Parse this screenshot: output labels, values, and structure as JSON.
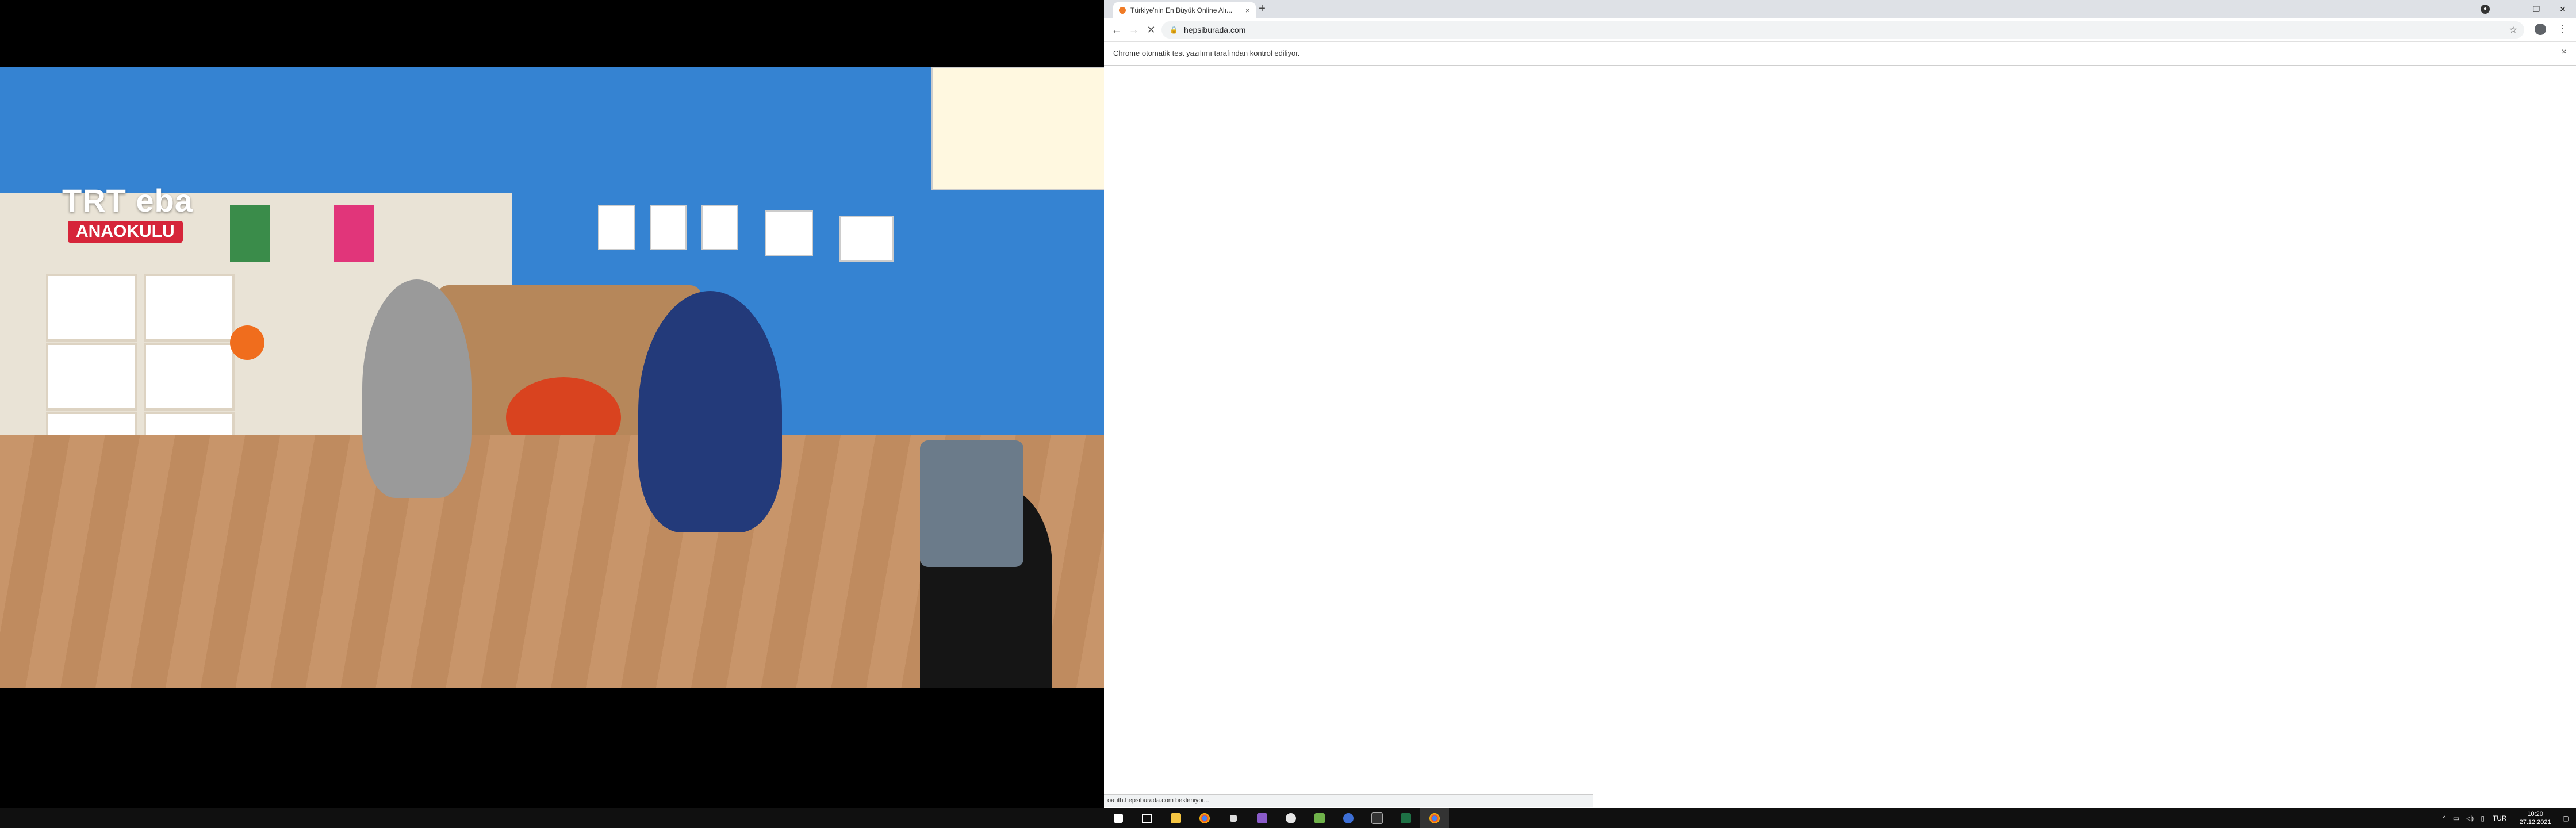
{
  "video": {
    "logo_trt": "TRT eba",
    "logo_sub": "ANAOKULU"
  },
  "browser": {
    "tab_title": "Türkiye'nin En Büyük Online Alı...",
    "tab_close": "×",
    "new_tab": "+",
    "url": "hepsiburada.com",
    "infobar_text": "Chrome otomatik test yazılımı tarafından kontrol ediliyor.",
    "infobar_close": "×",
    "status_text": "oauth.hepsiburada.com bekleniyor...",
    "window_controls": {
      "minimize": "–",
      "maximize": "❐",
      "close": "✕"
    },
    "nav": {
      "back": "←",
      "forward": "→",
      "reload": "✕"
    },
    "star": "☆",
    "menu": "⋮"
  },
  "taskbar": {
    "language": "TUR",
    "time": "10:20",
    "date": "27.12.2021",
    "icons": [
      "windows-start-icon",
      "task-view-icon",
      "file-explorer-icon",
      "chrome-icon",
      "pin-icon",
      "visual-studio-icon",
      "settings-icon",
      "notepad-icon",
      "teams-icon",
      "terminal-icon",
      "excel-icon",
      "chrome-active-icon"
    ]
  }
}
